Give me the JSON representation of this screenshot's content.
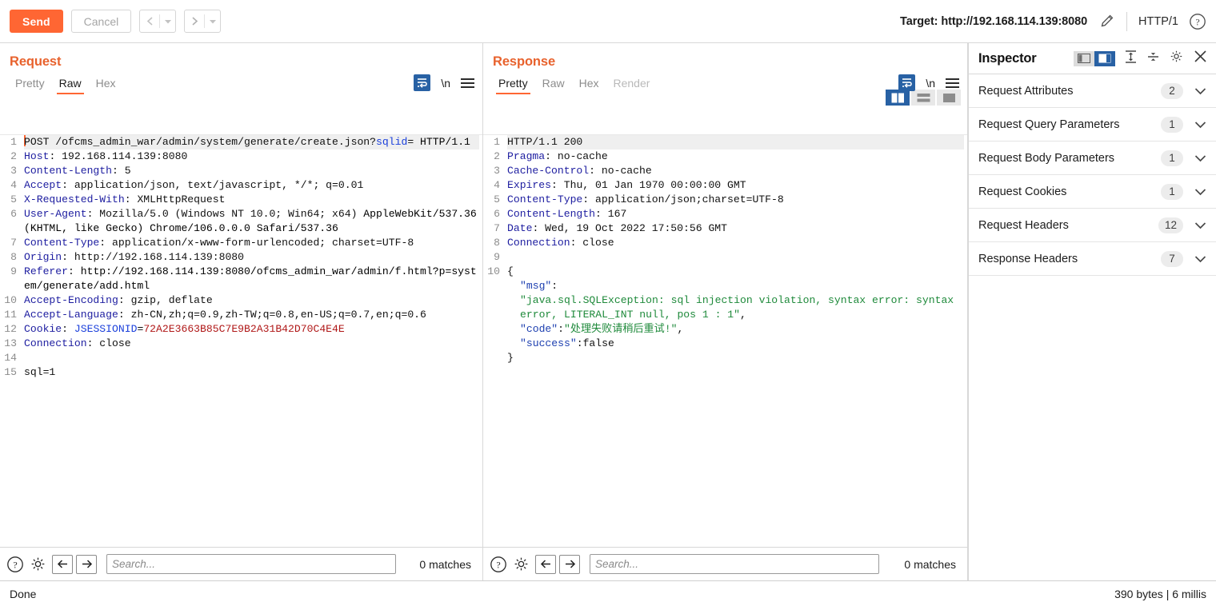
{
  "toolbar": {
    "send_label": "Send",
    "cancel_label": "Cancel",
    "prev_icon": "chevron-left-icon",
    "next_icon": "chevron-right-icon",
    "target_label": "Target: http://192.168.114.139:8080",
    "edit_icon": "pencil-icon",
    "http_version": "HTTP/1",
    "help_icon": "help-circle-icon",
    "accent_color": "#ff6633"
  },
  "request": {
    "title": "Request",
    "tabs": [
      {
        "label": "Pretty",
        "active": false
      },
      {
        "label": "Raw",
        "active": true
      },
      {
        "label": "Hex",
        "active": false
      }
    ],
    "wrap_icon": "word-wrap-icon",
    "newline_label": "\\n",
    "menu_icon": "hamburger-menu-icon",
    "lines": [
      {
        "n": "1",
        "first": true,
        "segments": [
          {
            "t": "cursor"
          },
          {
            "t": "plain",
            "v": "POST /ofcms_admin_war/admin/system/generate/create.json?"
          },
          {
            "t": "qparam",
            "v": "sqlid"
          },
          {
            "t": "plain",
            "v": "="
          },
          {
            "t": "wrap",
            "v": "HTTP/1.1"
          }
        ]
      },
      {
        "n": "2",
        "segments": [
          {
            "t": "hdr",
            "v": "Host"
          },
          {
            "t": "plain",
            "v": ": 192.168.114.139:8080"
          }
        ]
      },
      {
        "n": "3",
        "segments": [
          {
            "t": "hdr",
            "v": "Content-Length"
          },
          {
            "t": "plain",
            "v": ": 5"
          }
        ]
      },
      {
        "n": "4",
        "segments": [
          {
            "t": "hdr",
            "v": "Accept"
          },
          {
            "t": "plain",
            "v": ": application/json, text/javascript, */*; q=0.01"
          }
        ]
      },
      {
        "n": "5",
        "segments": [
          {
            "t": "hdr",
            "v": "X-Requested-With"
          },
          {
            "t": "plain",
            "v": ": XMLHttpRequest"
          }
        ]
      },
      {
        "n": "6",
        "segments": [
          {
            "t": "hdr",
            "v": "User-Agent"
          },
          {
            "t": "plain",
            "v": ": Mozilla/5.0 (Windows NT 10.0; Win64; x64)"
          },
          {
            "t": "wrap",
            "v": "AppleWebKit/537.36 (KHTML, like Gecko) Chrome/106.0.0.0 Safari/537.36"
          }
        ]
      },
      {
        "n": "7",
        "segments": [
          {
            "t": "hdr",
            "v": "Content-Type"
          },
          {
            "t": "plain",
            "v": ": application/x-www-form-urlencoded; charset=UTF-8"
          }
        ]
      },
      {
        "n": "8",
        "segments": [
          {
            "t": "hdr",
            "v": "Origin"
          },
          {
            "t": "plain",
            "v": ": http://192.168.114.139:8080"
          }
        ]
      },
      {
        "n": "9",
        "segments": [
          {
            "t": "hdr",
            "v": "Referer"
          },
          {
            "t": "plain",
            "v": ":"
          },
          {
            "t": "wrap",
            "v": "http://192.168.114.139:8080/ofcms_admin_war/admin/f.html?p=system/generate/add.html"
          }
        ]
      },
      {
        "n": "10",
        "segments": [
          {
            "t": "hdr",
            "v": "Accept-Encoding"
          },
          {
            "t": "plain",
            "v": ": gzip, deflate"
          }
        ]
      },
      {
        "n": "11",
        "segments": [
          {
            "t": "hdr",
            "v": "Accept-Language"
          },
          {
            "t": "plain",
            "v": ": zh-CN,zh;q=0.9,zh-TW;q=0.8,en-US;q=0.7,en;q=0.6"
          }
        ]
      },
      {
        "n": "12",
        "segments": [
          {
            "t": "hdr",
            "v": "Cookie"
          },
          {
            "t": "plain",
            "v": ": "
          },
          {
            "t": "ckname",
            "v": "JSESSIONID"
          },
          {
            "t": "plain",
            "v": "="
          },
          {
            "t": "ckval",
            "v": "72A2E3663B85C7E9B2A31B42D70C4E4E"
          }
        ]
      },
      {
        "n": "13",
        "segments": [
          {
            "t": "hdr",
            "v": "Connection"
          },
          {
            "t": "plain",
            "v": ": close"
          }
        ]
      },
      {
        "n": "14",
        "segments": []
      },
      {
        "n": "15",
        "segments": [
          {
            "t": "plain",
            "v": "sql=1"
          }
        ]
      }
    ],
    "search": {
      "help_icon": "help-circle-icon",
      "settings_icon": "gear-icon",
      "prev_icon": "arrow-left-icon",
      "next_icon": "arrow-right-icon",
      "placeholder": "Search...",
      "value": "",
      "matches_label": "0 matches"
    }
  },
  "response": {
    "title": "Response",
    "tabs": [
      {
        "label": "Pretty",
        "active": true
      },
      {
        "label": "Raw",
        "active": false
      },
      {
        "label": "Hex",
        "active": false
      },
      {
        "label": "Render",
        "active": false,
        "disabled": true
      }
    ],
    "wrap_icon": "word-wrap-icon",
    "newline_label": "\\n",
    "menu_icon": "hamburger-menu-icon",
    "layout_buttons": [
      {
        "name": "layout-side-by-side",
        "active": true
      },
      {
        "name": "layout-stacked",
        "active": false
      },
      {
        "name": "layout-single",
        "active": false
      }
    ],
    "lines": [
      {
        "n": "1",
        "first": true,
        "segments": [
          {
            "t": "plain",
            "v": "HTTP/1.1 200"
          }
        ]
      },
      {
        "n": "2",
        "segments": [
          {
            "t": "hdr",
            "v": "Pragma"
          },
          {
            "t": "plain",
            "v": ": no-cache"
          }
        ]
      },
      {
        "n": "3",
        "segments": [
          {
            "t": "hdr",
            "v": "Cache-Control"
          },
          {
            "t": "plain",
            "v": ": no-cache"
          }
        ]
      },
      {
        "n": "4",
        "segments": [
          {
            "t": "hdr",
            "v": "Expires"
          },
          {
            "t": "plain",
            "v": ": Thu, 01 Jan 1970 00:00:00 GMT"
          }
        ]
      },
      {
        "n": "5",
        "segments": [
          {
            "t": "hdr",
            "v": "Content-Type"
          },
          {
            "t": "plain",
            "v": ": application/json;charset=UTF-8"
          }
        ]
      },
      {
        "n": "6",
        "segments": [
          {
            "t": "hdr",
            "v": "Content-Length"
          },
          {
            "t": "plain",
            "v": ": 167"
          }
        ]
      },
      {
        "n": "7",
        "segments": [
          {
            "t": "hdr",
            "v": "Date"
          },
          {
            "t": "plain",
            "v": ": Wed, 19 Oct 2022 17:50:56 GMT"
          }
        ]
      },
      {
        "n": "8",
        "segments": [
          {
            "t": "hdr",
            "v": "Connection"
          },
          {
            "t": "plain",
            "v": ": close"
          }
        ]
      },
      {
        "n": "9",
        "segments": []
      },
      {
        "n": "10",
        "segments": [
          {
            "t": "plain",
            "v": "{"
          }
        ]
      },
      {
        "n": "",
        "indent": true,
        "segments": [
          {
            "t": "jkey",
            "v": "\"msg\""
          },
          {
            "t": "plain",
            "v": ":"
          }
        ]
      },
      {
        "n": "",
        "indent": true,
        "segments": [
          {
            "t": "jstr",
            "v": "\"java.sql.SQLException: sql injection violation, syntax error: syntax error, LITERAL_INT null, pos 1 : 1\""
          },
          {
            "t": "plain",
            "v": ","
          }
        ]
      },
      {
        "n": "",
        "indent": true,
        "segments": [
          {
            "t": "jkey",
            "v": "\"code\""
          },
          {
            "t": "plain",
            "v": ":"
          },
          {
            "t": "jstr",
            "v": "\"处理失败请稍后重试!\""
          },
          {
            "t": "plain",
            "v": ","
          }
        ]
      },
      {
        "n": "",
        "indent": true,
        "segments": [
          {
            "t": "jkey",
            "v": "\"success\""
          },
          {
            "t": "plain",
            "v": ":false"
          }
        ]
      },
      {
        "n": "",
        "segments": [
          {
            "t": "plain",
            "v": "}"
          }
        ]
      }
    ],
    "search": {
      "help_icon": "help-circle-icon",
      "settings_icon": "gear-icon",
      "prev_icon": "arrow-left-icon",
      "next_icon": "arrow-right-icon",
      "placeholder": "Search...",
      "value": "",
      "matches_label": "0 matches"
    }
  },
  "inspector": {
    "title": "Inspector",
    "view_toggle_left": "panel-left-icon",
    "view_toggle_right": "panel-right-icon",
    "expand_icon": "expand-all-icon",
    "collapse_icon": "collapse-all-icon",
    "settings_icon": "gear-icon",
    "close_icon": "close-icon",
    "sections": [
      {
        "label": "Request Attributes",
        "count": "2"
      },
      {
        "label": "Request Query Parameters",
        "count": "1"
      },
      {
        "label": "Request Body Parameters",
        "count": "1"
      },
      {
        "label": "Request Cookies",
        "count": "1"
      },
      {
        "label": "Request Headers",
        "count": "12"
      },
      {
        "label": "Response Headers",
        "count": "7"
      }
    ]
  },
  "statusbar": {
    "left_text": "Done",
    "right_text": "390 bytes | 6 millis"
  }
}
